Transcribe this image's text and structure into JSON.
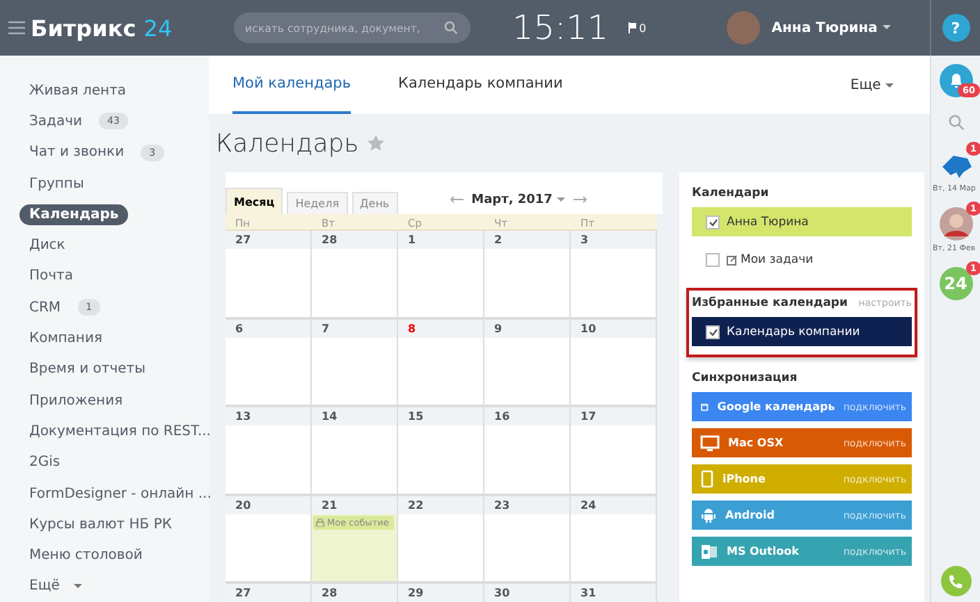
{
  "header": {
    "logo_text": "Битрикс",
    "logo_num": "24",
    "search_placeholder": "искать сотрудника, документ,",
    "time": "15:11",
    "flag_count": "0",
    "user": "Анна Тюрина",
    "help": "?"
  },
  "sidebar": {
    "items": [
      {
        "label": "Живая лента",
        "selected": false
      },
      {
        "label": "Задачи",
        "count": "43",
        "selected": false
      },
      {
        "label": "Чат и звонки",
        "count": "3",
        "selected": false
      },
      {
        "label": "Группы",
        "selected": false
      },
      {
        "label": "Календарь",
        "selected": true
      },
      {
        "label": "Диск",
        "selected": false
      },
      {
        "label": "Почта",
        "selected": false
      },
      {
        "label": "CRM",
        "count": "1",
        "selected": false
      },
      {
        "label": "Компания",
        "selected": false
      },
      {
        "label": "Время и отчеты",
        "selected": false
      },
      {
        "label": "Приложения",
        "selected": false
      },
      {
        "label": "Документация по REST...",
        "selected": false
      },
      {
        "label": "2Gis",
        "selected": false
      },
      {
        "label": "FormDesigner - онлайн ...",
        "selected": false
      },
      {
        "label": "Курсы валют НБ РК",
        "selected": false
      },
      {
        "label": "Меню столовой",
        "selected": false
      },
      {
        "label": "Ещё",
        "selected": false
      }
    ]
  },
  "tabs": [
    {
      "label": "Мой календарь",
      "selected": true
    },
    {
      "label": "Календарь компании",
      "selected": false
    }
  ],
  "more": "Еще",
  "title": "Календарь",
  "calendar": {
    "views": [
      {
        "label": "Месяц",
        "selected": true
      },
      {
        "label": "Неделя",
        "selected": false
      },
      {
        "label": "День",
        "selected": false
      }
    ],
    "month": "Март, 2017",
    "weekdays": [
      "Пн",
      "Вт",
      "Ср",
      "Чт",
      "Пт"
    ],
    "weeks": [
      [
        {
          "day": "27",
          "holiday": false
        },
        {
          "day": "28",
          "holiday": false
        },
        {
          "day": "1",
          "holiday": false
        },
        {
          "day": "2",
          "holiday": false
        },
        {
          "day": "3",
          "holiday": false
        }
      ],
      [
        {
          "day": "6",
          "holiday": false
        },
        {
          "day": "7",
          "holiday": false
        },
        {
          "day": "8",
          "holiday": true
        },
        {
          "day": "9",
          "holiday": false
        },
        {
          "day": "10",
          "holiday": false
        }
      ],
      [
        {
          "day": "13",
          "holiday": false
        },
        {
          "day": "14",
          "holiday": false
        },
        {
          "day": "15",
          "holiday": false
        },
        {
          "day": "16",
          "holiday": false
        },
        {
          "day": "17",
          "holiday": false
        }
      ],
      [
        {
          "day": "20",
          "holiday": false
        },
        {
          "day": "21",
          "holiday": false,
          "event": "Мое событие"
        },
        {
          "day": "22",
          "holiday": false
        },
        {
          "day": "23",
          "holiday": false
        },
        {
          "day": "24",
          "holiday": false
        }
      ],
      [
        {
          "day": "27",
          "holiday": false
        },
        {
          "day": "28",
          "holiday": false
        },
        {
          "day": "29",
          "holiday": false
        },
        {
          "day": "30",
          "holiday": false
        },
        {
          "day": "31",
          "holiday": false
        }
      ]
    ]
  },
  "calendars": {
    "heading": "Календари",
    "items": [
      {
        "label": "Анна Тюрина",
        "checked": true,
        "color": "#d4e56b"
      },
      {
        "label": "Мои задачи",
        "checked": false,
        "task": true
      }
    ]
  },
  "favorites": {
    "heading": "Избранные календари",
    "action": "настроить",
    "items": [
      {
        "label": "Календарь компании",
        "checked": true,
        "color": "#0f2150"
      }
    ]
  },
  "sync": {
    "heading": "Синхронизация",
    "items": [
      {
        "kind": "google",
        "label": "Google календарь",
        "action": "подключить",
        "color": "#3b86f0"
      },
      {
        "kind": "mac",
        "label": "Mac OSX",
        "action": "подключить",
        "color": "#d95a05"
      },
      {
        "kind": "iphone",
        "label": "iPhone",
        "action": "подключить",
        "color": "#cfae00"
      },
      {
        "kind": "android",
        "label": "Android",
        "action": "подключить",
        "color": "#3b9fd4"
      },
      {
        "kind": "outlook",
        "label": "MS Outlook",
        "action": "подключить",
        "color": "#36a3b0"
      }
    ]
  },
  "rail": {
    "notifications": "60",
    "items": [
      {
        "kind": "bird",
        "badge": "1",
        "date": "Вт, 14 Мар"
      },
      {
        "kind": "person",
        "badge": "1",
        "date": "Вт, 21 Фев"
      },
      {
        "kind": "logo",
        "text": "24",
        "badge": "1"
      }
    ]
  }
}
